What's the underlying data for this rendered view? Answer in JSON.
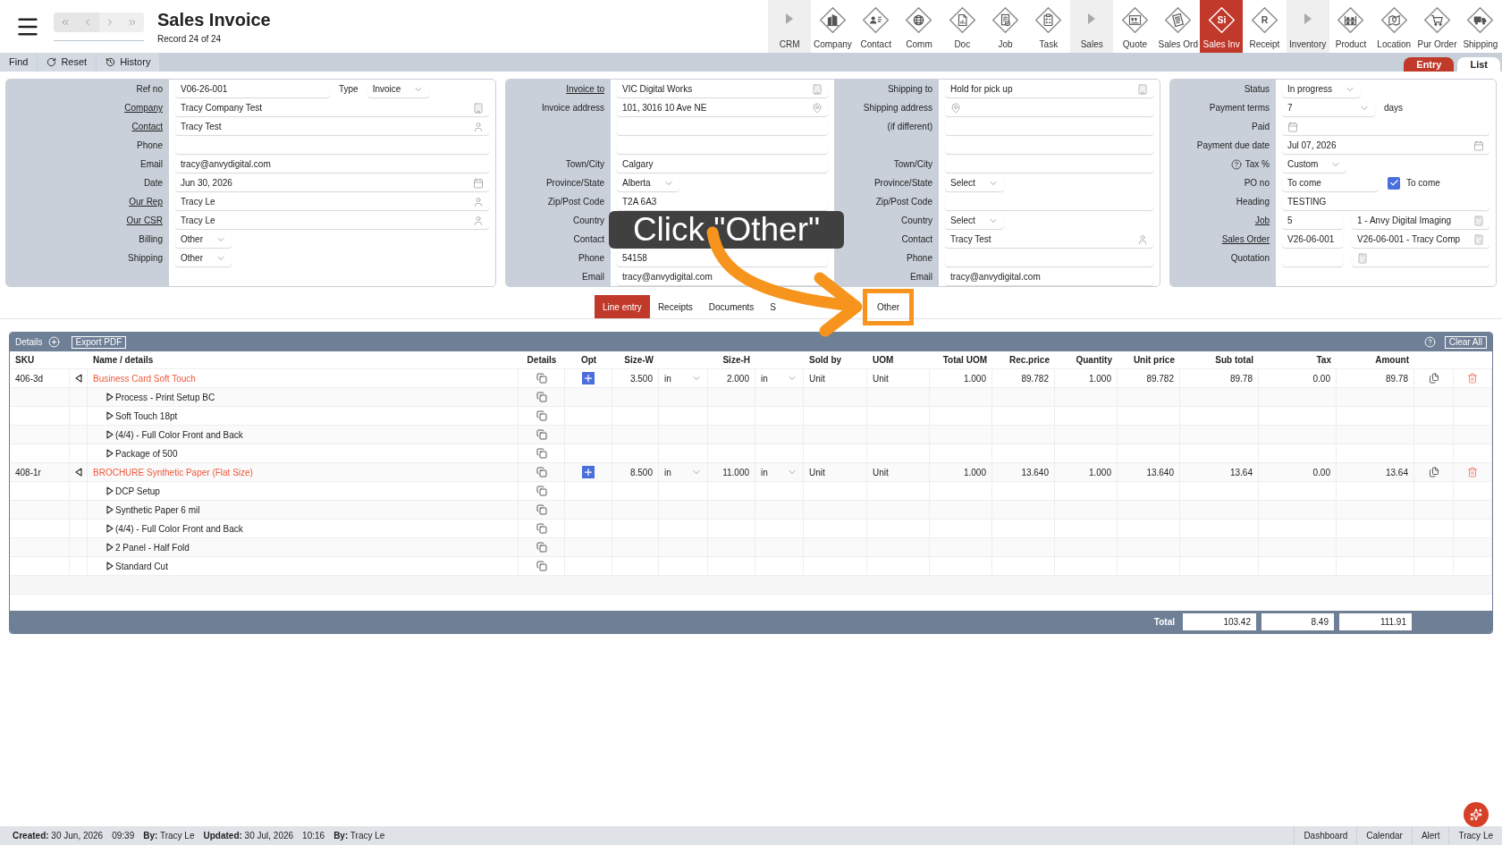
{
  "header": {
    "title": "Sales Invoice",
    "subtitle": "Record 24 of 24"
  },
  "modules": [
    {
      "label": "CRM",
      "kind": "section",
      "selected": false
    },
    {
      "label": "Company",
      "kind": "module",
      "selected": false
    },
    {
      "label": "Contact",
      "kind": "module",
      "selected": false
    },
    {
      "label": "Comm",
      "kind": "module",
      "selected": false
    },
    {
      "label": "Doc",
      "kind": "module",
      "selected": false
    },
    {
      "label": "Job",
      "kind": "module",
      "selected": false
    },
    {
      "label": "Task",
      "kind": "module",
      "selected": false
    },
    {
      "label": "Sales",
      "kind": "section",
      "selected": false
    },
    {
      "label": "Quote",
      "kind": "module",
      "selected": false
    },
    {
      "label": "Sales Ord",
      "kind": "module",
      "selected": false
    },
    {
      "label": "Sales Inv",
      "kind": "letter",
      "letter": "Si",
      "selected": true
    },
    {
      "label": "Receipt",
      "kind": "letter",
      "letter": "R",
      "selected": false
    },
    {
      "label": "Inventory",
      "kind": "section",
      "selected": false
    },
    {
      "label": "Product",
      "kind": "module",
      "selected": false
    },
    {
      "label": "Location",
      "kind": "module",
      "selected": false
    },
    {
      "label": "Pur Order",
      "kind": "module",
      "selected": false
    },
    {
      "label": "Shipping",
      "kind": "module",
      "selected": false
    }
  ],
  "toolbar": {
    "actions": [
      {
        "label": "Find",
        "kind": "plain"
      },
      {
        "label": "Reset",
        "kind": "reset"
      },
      {
        "label": "History",
        "kind": "history"
      }
    ],
    "views": [
      {
        "label": "Entry",
        "selected": true
      },
      {
        "label": "List",
        "selected": false
      }
    ]
  },
  "form": {
    "general": [
      {
        "label": "Ref no",
        "link": false,
        "fields": [
          {
            "kind": "text",
            "value": "V06-26-001"
          },
          {
            "kind": "caption",
            "text": "Type"
          },
          {
            "kind": "select",
            "value": "Invoice"
          }
        ]
      },
      {
        "label": "Company",
        "link": true,
        "fields": [
          {
            "kind": "lookup",
            "value": "Tracy Company Test"
          }
        ]
      },
      {
        "label": "Contact",
        "link": true,
        "fields": [
          {
            "kind": "person",
            "value": "Tracy Test"
          }
        ]
      },
      {
        "label": "Phone",
        "link": false,
        "fields": [
          {
            "kind": "text"
          }
        ]
      },
      {
        "label": "Email",
        "link": false,
        "fields": [
          {
            "kind": "text",
            "value": "tracy@anvydigital.com"
          }
        ]
      },
      {
        "label": "Date",
        "link": false,
        "fields": [
          {
            "kind": "date",
            "value": "Jun 30, 2026"
          }
        ]
      },
      {
        "label": "Our Rep",
        "link": true,
        "fields": [
          {
            "kind": "person",
            "value": "Tracy Le"
          }
        ]
      },
      {
        "label": "Our CSR",
        "link": true,
        "fields": [
          {
            "kind": "person",
            "value": "Tracy Le"
          }
        ]
      },
      {
        "label": "Billing",
        "link": false,
        "fields": [
          {
            "kind": "select",
            "value": "Other"
          }
        ]
      },
      {
        "label": "Shipping",
        "link": false,
        "fields": [
          {
            "kind": "select",
            "value": "Other"
          }
        ]
      }
    ],
    "invoice": [
      {
        "label": "Invoice to",
        "link": true,
        "fields": [
          {
            "kind": "lookup",
            "value": "VIC Digital Works"
          }
        ]
      },
      {
        "label": "Invoice address",
        "link": false,
        "fields": [
          {
            "kind": "address",
            "value": "101, 3016 10 Ave NE"
          }
        ]
      },
      {
        "fields": [
          {
            "kind": "text"
          }
        ]
      },
      {
        "fields": [
          {
            "kind": "text"
          }
        ]
      },
      {
        "label": "Town/City",
        "link": false,
        "fields": [
          {
            "kind": "text",
            "value": "Calgary"
          }
        ]
      },
      {
        "label": "Province/State",
        "link": false,
        "fields": [
          {
            "kind": "select",
            "value": "Alberta"
          }
        ]
      },
      {
        "label": "Zip/Post Code",
        "link": false,
        "fields": [
          {
            "kind": "text",
            "value": "T2A 6A3"
          }
        ]
      },
      {
        "label": "Country",
        "link": false
      },
      {
        "label": "Contact",
        "link": false
      },
      {
        "label": "Phone",
        "link": false,
        "fields": [
          {
            "kind": "text",
            "value": "54158"
          }
        ]
      },
      {
        "label": "Email",
        "link": false,
        "fields": [
          {
            "kind": "text",
            "value": "tracy@anvydigital.com"
          }
        ]
      }
    ],
    "shipping": [
      {
        "label": "Shipping to",
        "link": false,
        "fields": [
          {
            "kind": "lookup",
            "value": "Hold for pick up"
          }
        ]
      },
      {
        "label": "Shipping address",
        "link": false,
        "fields": [
          {
            "kind": "address"
          }
        ]
      },
      {
        "label": "(if different)",
        "link": false,
        "fields": [
          {
            "kind": "text"
          }
        ]
      },
      {
        "fields": [
          {
            "kind": "text"
          }
        ]
      },
      {
        "label": "Town/City",
        "link": false,
        "fields": [
          {
            "kind": "text"
          }
        ]
      },
      {
        "label": "Province/State",
        "link": false,
        "fields": [
          {
            "kind": "select",
            "value": "Select"
          }
        ]
      },
      {
        "label": "Zip/Post Code",
        "link": false,
        "fields": [
          {
            "kind": "text"
          }
        ]
      },
      {
        "label": "Country",
        "link": false,
        "fields": [
          {
            "kind": "select",
            "value": "Select"
          }
        ]
      },
      {
        "label": "Contact",
        "link": false,
        "fields": [
          {
            "kind": "person",
            "value": "Tracy Test"
          }
        ]
      },
      {
        "label": "Phone",
        "link": false,
        "fields": [
          {
            "kind": "text"
          }
        ]
      },
      {
        "label": "Email",
        "link": false,
        "fields": [
          {
            "kind": "text",
            "value": "tracy@anvydigital.com"
          }
        ]
      }
    ],
    "terms": [
      {
        "label": "Status",
        "link": false,
        "fields": [
          {
            "kind": "select",
            "value": "In progress"
          }
        ]
      },
      {
        "label": "Payment terms",
        "link": false,
        "fields": [
          {
            "kind": "select",
            "value": "7"
          },
          {
            "kind": "caption",
            "text": "days"
          }
        ]
      },
      {
        "label": "Paid",
        "link": false,
        "fields": [
          {
            "kind": "date"
          }
        ]
      },
      {
        "label": "Payment due date",
        "link": false,
        "fields": [
          {
            "kind": "date",
            "value": "Jul 07, 2026"
          }
        ]
      },
      {
        "label": "Tax %",
        "link": false,
        "help": true,
        "fields": [
          {
            "kind": "select",
            "value": "Custom"
          }
        ]
      },
      {
        "label": "PO no",
        "link": false,
        "fields": [
          {
            "kind": "text",
            "value": "To come"
          },
          {
            "kind": "checkbox",
            "checked": true,
            "text": "To come"
          }
        ]
      },
      {
        "label": "Heading",
        "link": false,
        "fields": [
          {
            "kind": "text",
            "value": "TESTING"
          }
        ]
      },
      {
        "label": "Job",
        "link": true,
        "fields": [
          {
            "kind": "text",
            "value": "5"
          },
          {
            "kind": "record",
            "value": "1 - Anvy Digital Imaging"
          }
        ]
      },
      {
        "label": "Sales Order",
        "link": true,
        "fields": [
          {
            "kind": "text",
            "value": "V26-06-001"
          },
          {
            "kind": "record",
            "value": "V26-06-001 - Tracy Comp"
          }
        ]
      },
      {
        "label": "Quotation",
        "link": false,
        "fields": [
          {
            "kind": "text"
          },
          {
            "kind": "record"
          }
        ]
      }
    ]
  },
  "tabs": [
    {
      "label": "Line entry",
      "selected": true,
      "partly_covered": false
    },
    {
      "label": "Receipts",
      "selected": false,
      "partly_covered": false
    },
    {
      "label": "Documents",
      "selected": false,
      "partly_covered": false
    },
    {
      "label": "S",
      "selected": false,
      "partly_covered": true
    },
    {
      "label": "Other",
      "selected": false,
      "partly_covered": false
    }
  ],
  "callout": {
    "text": "Click \"Other\""
  },
  "details": {
    "title": "Details",
    "export": "Export PDF",
    "clear": "Clear All",
    "columns": [
      "SKU",
      "Name / details",
      "Details",
      "Opt",
      "Size-W",
      "Size-H",
      "Sold by",
      "UOM",
      "Total UOM",
      "Rec.price",
      "Quantity",
      "Unit price",
      "Sub total",
      "Tax",
      "Amount"
    ],
    "rows": [
      {
        "sku": "406-3d",
        "name": "Business Card Soft Touch",
        "expanded": true,
        "size_w": "3.500",
        "unit_w": "in",
        "size_h": "2.000",
        "unit_h": "in",
        "sold_by": "Unit",
        "uom": "Unit",
        "total_uom": "1.000",
        "rec_price": "89.782",
        "quantity": "1.000",
        "unit_price": "89.782",
        "sub_total": "89.78",
        "tax": "0.00",
        "amount": "89.78",
        "children": [
          {
            "name": "Process - Print Setup BC"
          },
          {
            "name": "Soft Touch 18pt"
          },
          {
            "name": "(4/4) - Full Color Front and Back"
          },
          {
            "name": "Package of 500"
          }
        ]
      },
      {
        "sku": "408-1r",
        "name": "BROCHURE Synthetic Paper (Flat Size)",
        "expanded": true,
        "size_w": "8.500",
        "unit_w": "in",
        "size_h": "11.000",
        "unit_h": "in",
        "sold_by": "Unit",
        "uom": "Unit",
        "total_uom": "1.000",
        "rec_price": "13.640",
        "quantity": "1.000",
        "unit_price": "13.640",
        "sub_total": "13.64",
        "tax": "0.00",
        "amount": "13.64",
        "children": [
          {
            "name": "DCP Setup"
          },
          {
            "name": "Synthetic Paper 6 mil"
          },
          {
            "name": "(4/4) - Full Color Front and Back"
          },
          {
            "name": "2 Panel - Half Fold"
          },
          {
            "name": "Standard Cut"
          }
        ]
      }
    ],
    "totals": {
      "label": "Total",
      "sub_total": "103.42",
      "tax": "8.49",
      "amount": "111.91"
    }
  },
  "status_bar": {
    "left": [
      "**Created:** 30 Jun, 2026",
      "09:39",
      "**By:** Tracy Le",
      "**Updated:** 30 Jul, 2026",
      "10:16",
      "**By:** Tracy Le"
    ],
    "right": [
      "Dashboard",
      "Calendar",
      "Alert",
      "Tracy Le"
    ]
  }
}
